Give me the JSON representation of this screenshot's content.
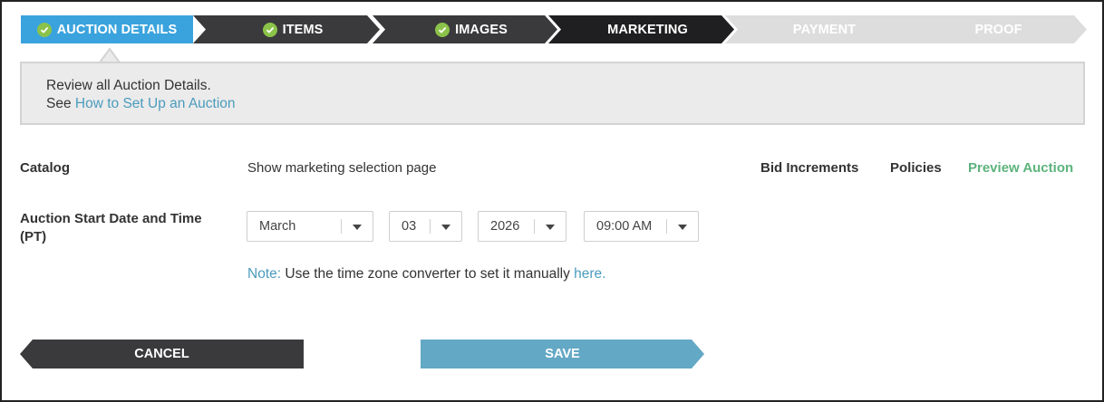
{
  "steps": [
    {
      "label": "AUCTION DETAILS",
      "state": "active",
      "completed": true
    },
    {
      "label": "ITEMS",
      "state": "done",
      "completed": true
    },
    {
      "label": "IMAGES",
      "state": "done",
      "completed": true
    },
    {
      "label": "MARKETING",
      "state": "done-current",
      "completed": false
    },
    {
      "label": "PAYMENT",
      "state": "pending",
      "completed": false
    },
    {
      "label": "PROOF",
      "state": "pending",
      "completed": false
    }
  ],
  "info": {
    "line1": "Review all Auction Details.",
    "line2_prefix": "See",
    "line2_link": "How to Set Up an Auction"
  },
  "catalog": {
    "label": "Catalog",
    "value": "Show marketing selection page"
  },
  "top_links": {
    "bid_increments": "Bid Increments",
    "policies": "Policies",
    "preview_auction": "Preview Auction"
  },
  "start_date": {
    "label_line1": "Auction Start Date and Time",
    "label_line2": "(PT)",
    "month": "March",
    "day": "03",
    "year": "2026",
    "time": "09:00 AM"
  },
  "note": {
    "prefix": "Note:",
    "text": "Use the time zone converter to set it manually",
    "link": "here."
  },
  "buttons": {
    "cancel": "CANCEL",
    "save": "SAVE"
  },
  "colors": {
    "active_step": "#3aa3dd",
    "done_step": "#3a3a3c",
    "current_step": "#1f1f21",
    "pending_step": "#dddddd",
    "check_green": "#8bc34a",
    "link_blue": "#4a9bbd",
    "preview_green": "#5cb37c",
    "save_blue": "#63a8c5",
    "cancel_dark": "#3a3a3c"
  }
}
